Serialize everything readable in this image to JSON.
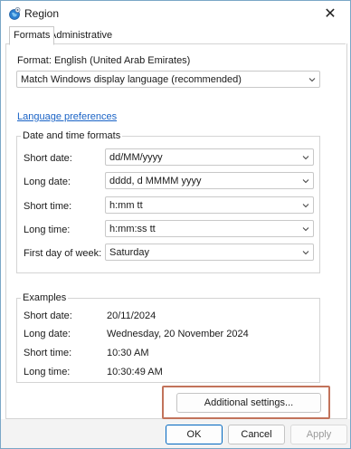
{
  "window": {
    "title": "Region",
    "close_glyph": "✕"
  },
  "tabs": [
    {
      "label": "Formats",
      "active": true
    },
    {
      "label": "Administrative",
      "active": false
    }
  ],
  "format": {
    "label": "Format: English (United Arab Emirates)",
    "value": "Match Windows display language (recommended)"
  },
  "language_preferences_link": "Language preferences",
  "date_time_formats": {
    "legend": "Date and time formats",
    "rows": [
      {
        "label": "Short date:",
        "value": "dd/MM/yyyy"
      },
      {
        "label": "Long date:",
        "value": "dddd, d MMMM yyyy"
      },
      {
        "label": "Short time:",
        "value": "h:mm tt"
      },
      {
        "label": "Long time:",
        "value": "h:mm:ss tt"
      },
      {
        "label": "First day of week:",
        "value": "Saturday"
      }
    ]
  },
  "examples": {
    "legend": "Examples",
    "rows": [
      {
        "label": "Short date:",
        "value": "20/11/2024"
      },
      {
        "label": "Long date:",
        "value": "Wednesday, 20 November 2024"
      },
      {
        "label": "Short time:",
        "value": "10:30 AM"
      },
      {
        "label": "Long time:",
        "value": "10:30:49 AM"
      }
    ]
  },
  "buttons": {
    "additional_settings": "Additional settings...",
    "ok": "OK",
    "cancel": "Cancel",
    "apply": "Apply"
  },
  "colors": {
    "accent": "#0067c0",
    "link": "#1a63c6",
    "highlight_box": "#c2735b"
  },
  "icons": {
    "title": "region-globe-icon",
    "chevron": "chevron-down-icon"
  }
}
